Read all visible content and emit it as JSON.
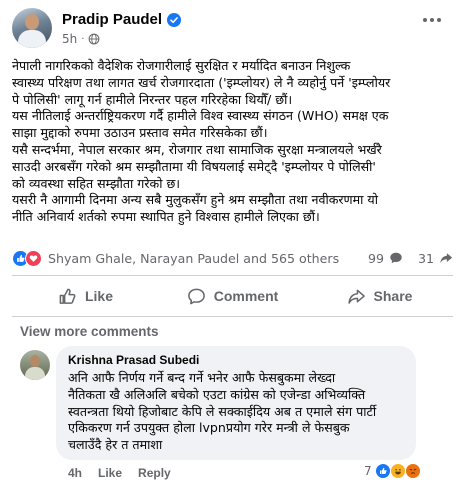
{
  "post": {
    "author": "Pradip Paudel",
    "time": "5h",
    "separator": "·",
    "text": "नेपाली नागरिकको वैदेशिक रोजगारीलाई सुरक्षित  र मर्यादित बनाउन निशुल्क\nस्वास्थ्य परिक्षण तथा लागत खर्च रोजगारदाता ('इम्प्लोयर) ले नै व्यहोर्नु पर्ने 'इम्प्लोयर\nपे पोलिसी' लागू गर्न हामीले निरन्तर पहल गरिरहेका थियौँ/ छौं।\nयस नीतिलाई अन्तर्राष्ट्रियकरण गर्दै हामीले विश्व स्वास्थ्य संगठन (WHO) समक्ष एक\nसाझा मुद्दाको रुपमा उठाउन प्रस्ताव समेत गरिसकेका छौं।\nयसै सन्दर्भमा, नेपाल सरकार श्रम, रोजगार तथा सामाजिक सुरक्षा मन्त्रालयले भर्खरै\nसाउदी अरबसँग गरेको श्रम सम्झौतामा यी विषयलाई समेट्दै 'इम्प्लोयर पे पोलिसी'\nको व्यवस्था सहित सम्झौता गरेको छ।\nयसरी नै आगामी दिनमा अन्य सबै मुलुकसँग हुने श्रम सम्झौता तथा नवीकरणमा यो\nनीति अनिवार्य शर्तको रुपमा स्थापित हुने विश्वास हामीले लिएका छौं।"
  },
  "reactions": {
    "summary": "Shyam Ghale, Narayan Paudel and 565 others",
    "comments_count": "99",
    "shares_count": "31"
  },
  "actions": {
    "like": "Like",
    "comment": "Comment",
    "share": "Share"
  },
  "comments": {
    "view_more": "View more comments",
    "items": [
      {
        "author": "Krishna Prasad Subedi",
        "text": "अनि आफै निर्णय गर्ने बन्द गर्ने भनेर आफै फेसबुकमा लेख्दा\nनैतिकता खै अलिअलि बचेको एउटा कांग्रेस को एजेन्डा अभिव्यक्ति\nस्वतन्त्रता थियो हिजोबाट केपि ले सक्काईदिय अब त एमाले संग पार्टी\nएकिकरण गर्न उपयुक्त होला  lvpnप्रयोग गरेर मन्त्री ले फेसबुक\nचलाउँदै हेर त तमाशा",
        "time": "4h",
        "like_label": "Like",
        "reply_label": "Reply",
        "reaction_count": "7"
      }
    ]
  },
  "colors": {
    "accent": "#1877f2",
    "love": "#f33e58",
    "haha": "#f7b125",
    "angry": "#e9710f",
    "secondary_text": "#65676b",
    "bubble_bg": "#f0f2f5"
  },
  "icons": [
    "verified-badge-icon",
    "globe-icon",
    "more-options-icon",
    "like-reaction-icon",
    "love-reaction-icon",
    "comment-icon",
    "share-icon",
    "like-icon",
    "haha-reaction-icon",
    "angry-reaction-icon"
  ]
}
